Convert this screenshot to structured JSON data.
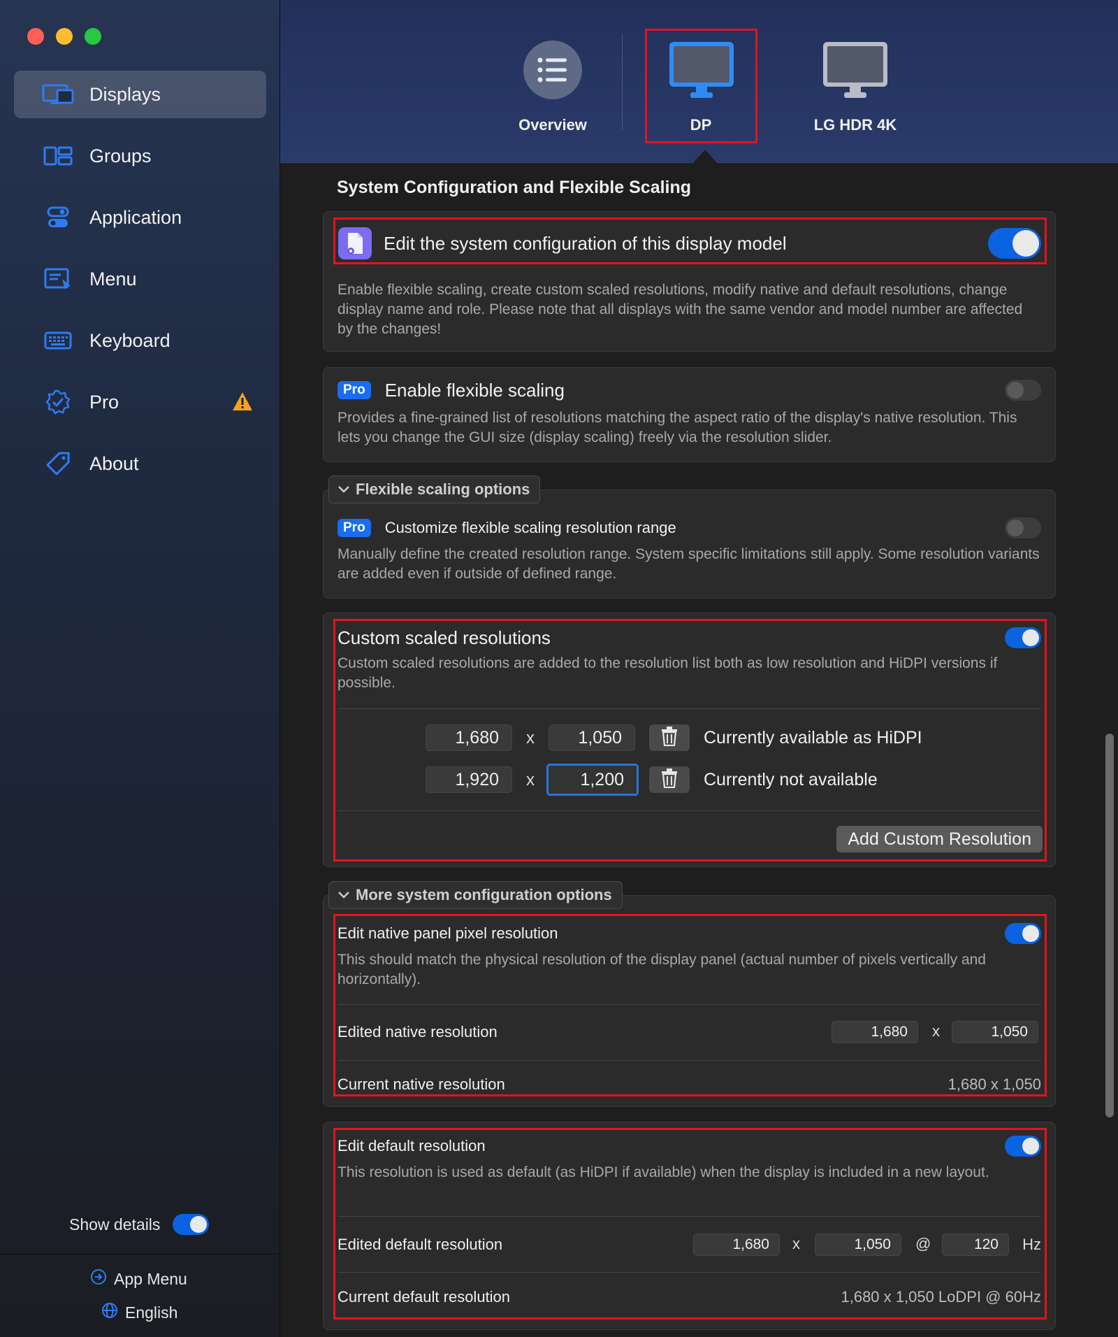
{
  "sidebar": {
    "items": [
      {
        "label": "Displays",
        "icon": "displays-icon",
        "active": true
      },
      {
        "label": "Groups",
        "icon": "groups-icon"
      },
      {
        "label": "Application",
        "icon": "application-icon"
      },
      {
        "label": "Menu",
        "icon": "menu-icon"
      },
      {
        "label": "Keyboard",
        "icon": "keyboard-icon"
      },
      {
        "label": "Pro",
        "icon": "pro-badge-icon",
        "warning": true
      },
      {
        "label": "About",
        "icon": "tag-icon"
      }
    ],
    "show_details_label": "Show details",
    "show_details_on": true,
    "app_menu_label": "App Menu",
    "language_label": "English"
  },
  "tabs": [
    {
      "label": "Overview",
      "icon": "list-icon"
    },
    {
      "label": "DP",
      "icon": "monitor-icon",
      "selected": true
    },
    {
      "label": "LG HDR 4K",
      "icon": "monitor-icon"
    }
  ],
  "section_title": "System Configuration and Flexible Scaling",
  "edit_config": {
    "title": "Edit the system configuration of this display model",
    "enabled": true,
    "description": "Enable flexible scaling, create custom scaled resolutions, modify native and default resolutions, change display name and role. Please note that all displays with the same vendor and model number are affected by the changes!"
  },
  "flexible_scaling": {
    "badge": "Pro",
    "title": "Enable flexible scaling",
    "enabled": false,
    "description": "Provides a fine-grained list of resolutions matching the aspect ratio of the display's native resolution. This lets you change the GUI size (display scaling) freely via the resolution slider."
  },
  "flexible_options": {
    "group_label": "Flexible scaling options",
    "badge": "Pro",
    "title": "Customize flexible scaling resolution range",
    "enabled": false,
    "description": "Manually define the created resolution range. System specific limitations still apply. Some resolution variants are added even if outside of defined range."
  },
  "custom_scaled": {
    "title": "Custom scaled resolutions",
    "enabled": true,
    "description": "Custom scaled resolutions are added to the resolution list both as low resolution and HiDPI versions if possible.",
    "separator": "x",
    "rows": [
      {
        "width": "1,680",
        "height": "1,050",
        "status": "Currently available as HiDPI"
      },
      {
        "width": "1,920",
        "height": "1,200",
        "status": "Currently not available"
      }
    ],
    "add_button": "Add Custom Resolution"
  },
  "more_options": {
    "group_label": "More system configuration options",
    "native": {
      "title": "Edit native panel pixel resolution",
      "enabled": true,
      "description": "This should match the physical resolution of the display panel (actual number of pixels vertically and horizontally).",
      "edited_label": "Edited native resolution",
      "edited_width": "1,680",
      "edited_height": "1,050",
      "separator": "x",
      "current_label": "Current native resolution",
      "current_value": "1,680 x 1,050"
    }
  },
  "default_res": {
    "title": "Edit default resolution",
    "enabled": true,
    "description": "This resolution is used as default (as HiDPI if available) when the display is included in a new layout.",
    "edited_label": "Edited default resolution",
    "edited_width": "1,680",
    "edited_height": "1,050",
    "edited_refresh": "120",
    "separator": "x",
    "at_sign": "@",
    "unit": "Hz",
    "current_label": "Current default resolution",
    "current_value": "1,680 x 1,050 LoDPI @ 60Hz"
  },
  "colors": {
    "accent": "#0a63e0",
    "highlight": "#e0141f",
    "pro_badge": "#1a6cf0",
    "warning": "#f7a21b"
  }
}
